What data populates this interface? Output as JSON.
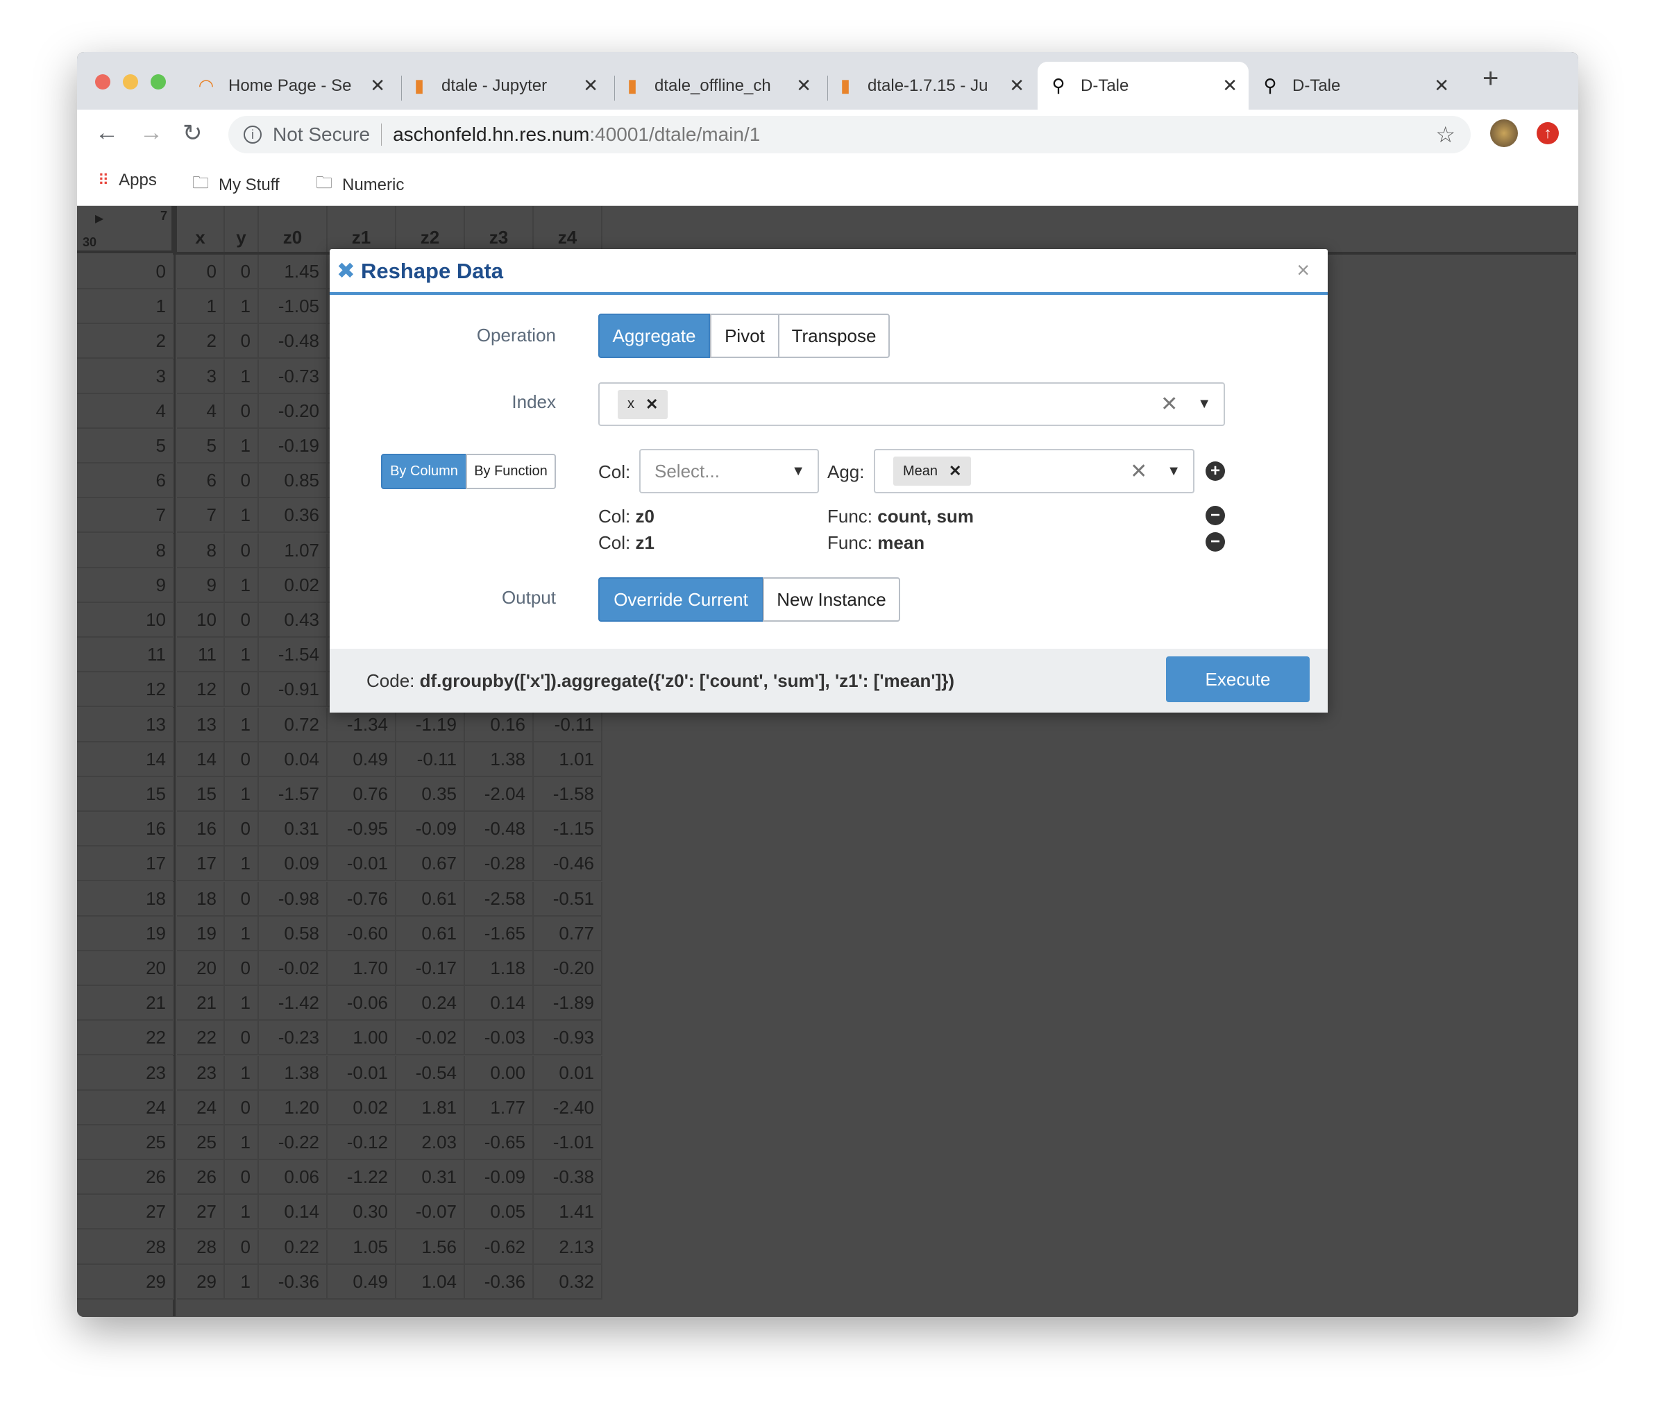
{
  "browser": {
    "tabs": [
      {
        "label": "Home Page - Se",
        "icon": "loading-spinner-icon"
      },
      {
        "label": "dtale - Jupyter",
        "icon": "notebook-icon"
      },
      {
        "label": "dtale_offline_ch",
        "icon": "notebook-icon"
      },
      {
        "label": "dtale-1.7.15 - Ju",
        "icon": "notebook-icon"
      },
      {
        "label": "D-Tale",
        "icon": "search-icon",
        "active": true
      },
      {
        "label": "D-Tale",
        "icon": "search-icon"
      }
    ],
    "security": "Not Secure",
    "url_host": "aschonfeld.hn.res.num",
    "url_path": ":40001/dtale/main/1",
    "bookmarks": [
      "Apps",
      "My Stuff",
      "Numeric"
    ]
  },
  "grid": {
    "row_count": "30",
    "col_count": "7",
    "columns": [
      "x",
      "y",
      "z0",
      "z1",
      "z2",
      "z3",
      "z4"
    ],
    "rows": [
      [
        "0",
        "0",
        "0",
        "1.45",
        null,
        null,
        null,
        null
      ],
      [
        "1",
        "1",
        "1",
        "-1.05",
        null,
        null,
        null,
        null
      ],
      [
        "2",
        "2",
        "0",
        "-0.48",
        null,
        null,
        null,
        null
      ],
      [
        "3",
        "3",
        "1",
        "-0.73",
        null,
        null,
        null,
        null
      ],
      [
        "4",
        "4",
        "0",
        "-0.20",
        null,
        null,
        null,
        null
      ],
      [
        "5",
        "5",
        "1",
        "-0.19",
        null,
        null,
        null,
        null
      ],
      [
        "6",
        "6",
        "0",
        "0.85",
        null,
        null,
        null,
        null
      ],
      [
        "7",
        "7",
        "1",
        "0.36",
        null,
        null,
        null,
        null
      ],
      [
        "8",
        "8",
        "0",
        "1.07",
        null,
        null,
        null,
        null
      ],
      [
        "9",
        "9",
        "1",
        "0.02",
        null,
        null,
        null,
        null
      ],
      [
        "10",
        "10",
        "0",
        "0.43",
        null,
        null,
        null,
        null
      ],
      [
        "11",
        "11",
        "1",
        "-1.54",
        null,
        null,
        null,
        null
      ],
      [
        "12",
        "12",
        "0",
        "-0.91",
        null,
        null,
        null,
        null
      ],
      [
        "13",
        "13",
        "1",
        "0.72",
        "-1.34",
        "-1.19",
        "0.16",
        "-0.11"
      ],
      [
        "14",
        "14",
        "0",
        "0.04",
        "0.49",
        "-0.11",
        "1.38",
        "1.01"
      ],
      [
        "15",
        "15",
        "1",
        "-1.57",
        "0.76",
        "0.35",
        "-2.04",
        "-1.58"
      ],
      [
        "16",
        "16",
        "0",
        "0.31",
        "-0.95",
        "-0.09",
        "-0.48",
        "-1.15"
      ],
      [
        "17",
        "17",
        "1",
        "0.09",
        "-0.01",
        "0.67",
        "-0.28",
        "-0.46"
      ],
      [
        "18",
        "18",
        "0",
        "-0.98",
        "-0.76",
        "0.61",
        "-2.58",
        "-0.51"
      ],
      [
        "19",
        "19",
        "1",
        "0.58",
        "-0.60",
        "0.61",
        "-1.65",
        "0.77"
      ],
      [
        "20",
        "20",
        "0",
        "-0.02",
        "1.70",
        "-0.17",
        "1.18",
        "-0.20"
      ],
      [
        "21",
        "21",
        "1",
        "-1.42",
        "-0.06",
        "0.24",
        "0.14",
        "-1.89"
      ],
      [
        "22",
        "22",
        "0",
        "-0.23",
        "1.00",
        "-0.02",
        "-0.03",
        "-0.93"
      ],
      [
        "23",
        "23",
        "1",
        "1.38",
        "-0.01",
        "-0.54",
        "0.00",
        "0.01"
      ],
      [
        "24",
        "24",
        "0",
        "1.20",
        "0.02",
        "1.81",
        "1.77",
        "-2.40"
      ],
      [
        "25",
        "25",
        "1",
        "-0.22",
        "-0.12",
        "2.03",
        "-0.65",
        "-1.01"
      ],
      [
        "26",
        "26",
        "0",
        "0.06",
        "-1.22",
        "0.31",
        "-0.09",
        "-0.38"
      ],
      [
        "27",
        "27",
        "1",
        "0.14",
        "0.30",
        "-0.07",
        "0.05",
        "1.41"
      ],
      [
        "28",
        "28",
        "0",
        "0.22",
        "1.05",
        "1.56",
        "-0.62",
        "2.13"
      ],
      [
        "29",
        "29",
        "1",
        "-0.36",
        "0.49",
        "1.04",
        "-0.36",
        "0.32"
      ]
    ]
  },
  "modal": {
    "title": "Reshape Data",
    "operation_label": "Operation",
    "operations": [
      "Aggregate",
      "Pivot",
      "Transpose"
    ],
    "index_label": "Index",
    "index_value": "x",
    "mode_toggle": [
      "By Column",
      "By Function"
    ],
    "col_label": "Col:",
    "col_placeholder": "Select...",
    "agg_label": "Agg:",
    "agg_value": "Mean",
    "func_label": "Func:",
    "aggregations": [
      {
        "col": "z0",
        "func": "count, sum"
      },
      {
        "col": "z1",
        "func": "mean"
      }
    ],
    "output_label": "Output",
    "outputs": [
      "Override Current",
      "New Instance"
    ],
    "code_label": "Code:",
    "code": "df.groupby(['x']).aggregate({'z0': ['count', 'sum'], 'z1': ['mean']})",
    "execute": "Execute",
    "accent": "#4a90cd"
  }
}
